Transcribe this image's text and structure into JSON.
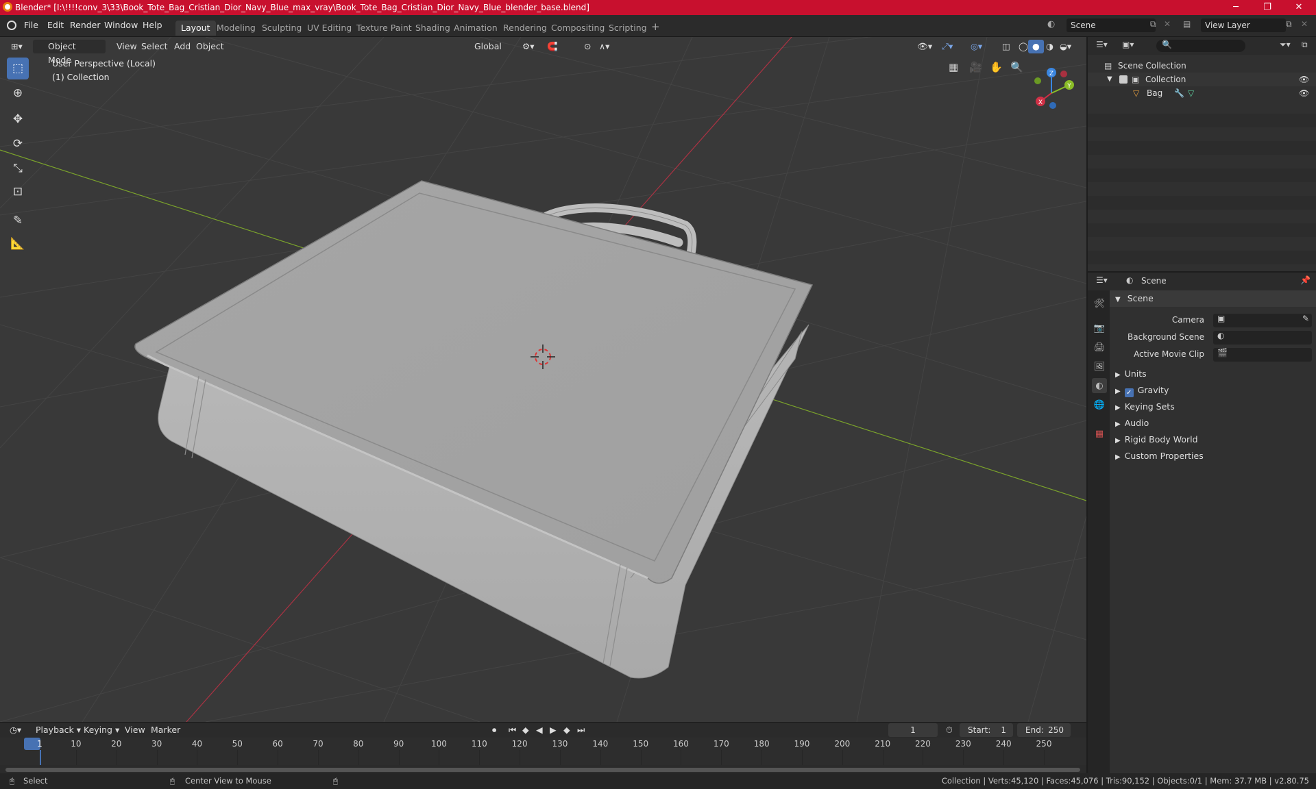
{
  "titlebar": {
    "title": "Blender* [I:\\!!!!conv_3\\33\\Book_Tote_Bag_Cristian_Dior_Navy_Blue_max_vray\\Book_Tote_Bag_Cristian_Dior_Navy_Blue_blender_base.blend]",
    "minimize": "─",
    "maximize": "❐",
    "close": "✕"
  },
  "menu": {
    "file": "File",
    "edit": "Edit",
    "render": "Render",
    "window": "Window",
    "help": "Help"
  },
  "workspaces": [
    "Layout",
    "Modeling",
    "Sculpting",
    "UV Editing",
    "Texture Paint",
    "Shading",
    "Animation",
    "Rendering",
    "Compositing",
    "Scripting"
  ],
  "workspace_add": "+",
  "scene_field": "Scene",
  "view_layer_field": "View Layer",
  "viewport_header": {
    "mode": "Object Mode",
    "view": "View",
    "select": "Select",
    "add": "Add",
    "object": "Object",
    "orientation": "Global"
  },
  "viewport_overlay": {
    "perspective": "User Perspective (Local)",
    "collection": "(1) Collection"
  },
  "gizmo": {
    "x": "X",
    "y": "Y",
    "z": "Z"
  },
  "outliner": {
    "scene_collection": "Scene Collection",
    "collection": "Collection",
    "object": "Bag"
  },
  "properties": {
    "context": "Scene",
    "panel_title": "Scene",
    "camera_label": "Camera",
    "background_scene_label": "Background Scene",
    "active_movie_clip_label": "Active Movie Clip",
    "sections": [
      "Units",
      "Gravity",
      "Keying Sets",
      "Audio",
      "Rigid Body World",
      "Custom Properties"
    ]
  },
  "timeline": {
    "playback": "Playback",
    "keying": "Keying",
    "view": "View",
    "marker": "Marker",
    "current_frame": "1",
    "start_label": "Start:",
    "start_value": "1",
    "end_label": "End:",
    "end_value": "250",
    "ruler": [
      "1",
      "10",
      "20",
      "30",
      "40",
      "50",
      "60",
      "70",
      "80",
      "90",
      "100",
      "110",
      "120",
      "130",
      "140",
      "150",
      "160",
      "170",
      "180",
      "190",
      "200",
      "210",
      "220",
      "230",
      "240",
      "250"
    ]
  },
  "statusbar": {
    "select": "Select",
    "center_view": "Center View to Mouse",
    "stats": "Collection | Verts:45,120 | Faces:45,076 | Tris:90,152 | Objects:0/1 | Mem: 37.7 MB | v2.80.75"
  },
  "colors": {
    "titlebar": "#c8102e",
    "accent": "#4772b3",
    "viewport_bg": "#393939",
    "x_axis": "#d03046",
    "y_axis": "#8bbd28",
    "z_axis": "#3a86e0"
  }
}
